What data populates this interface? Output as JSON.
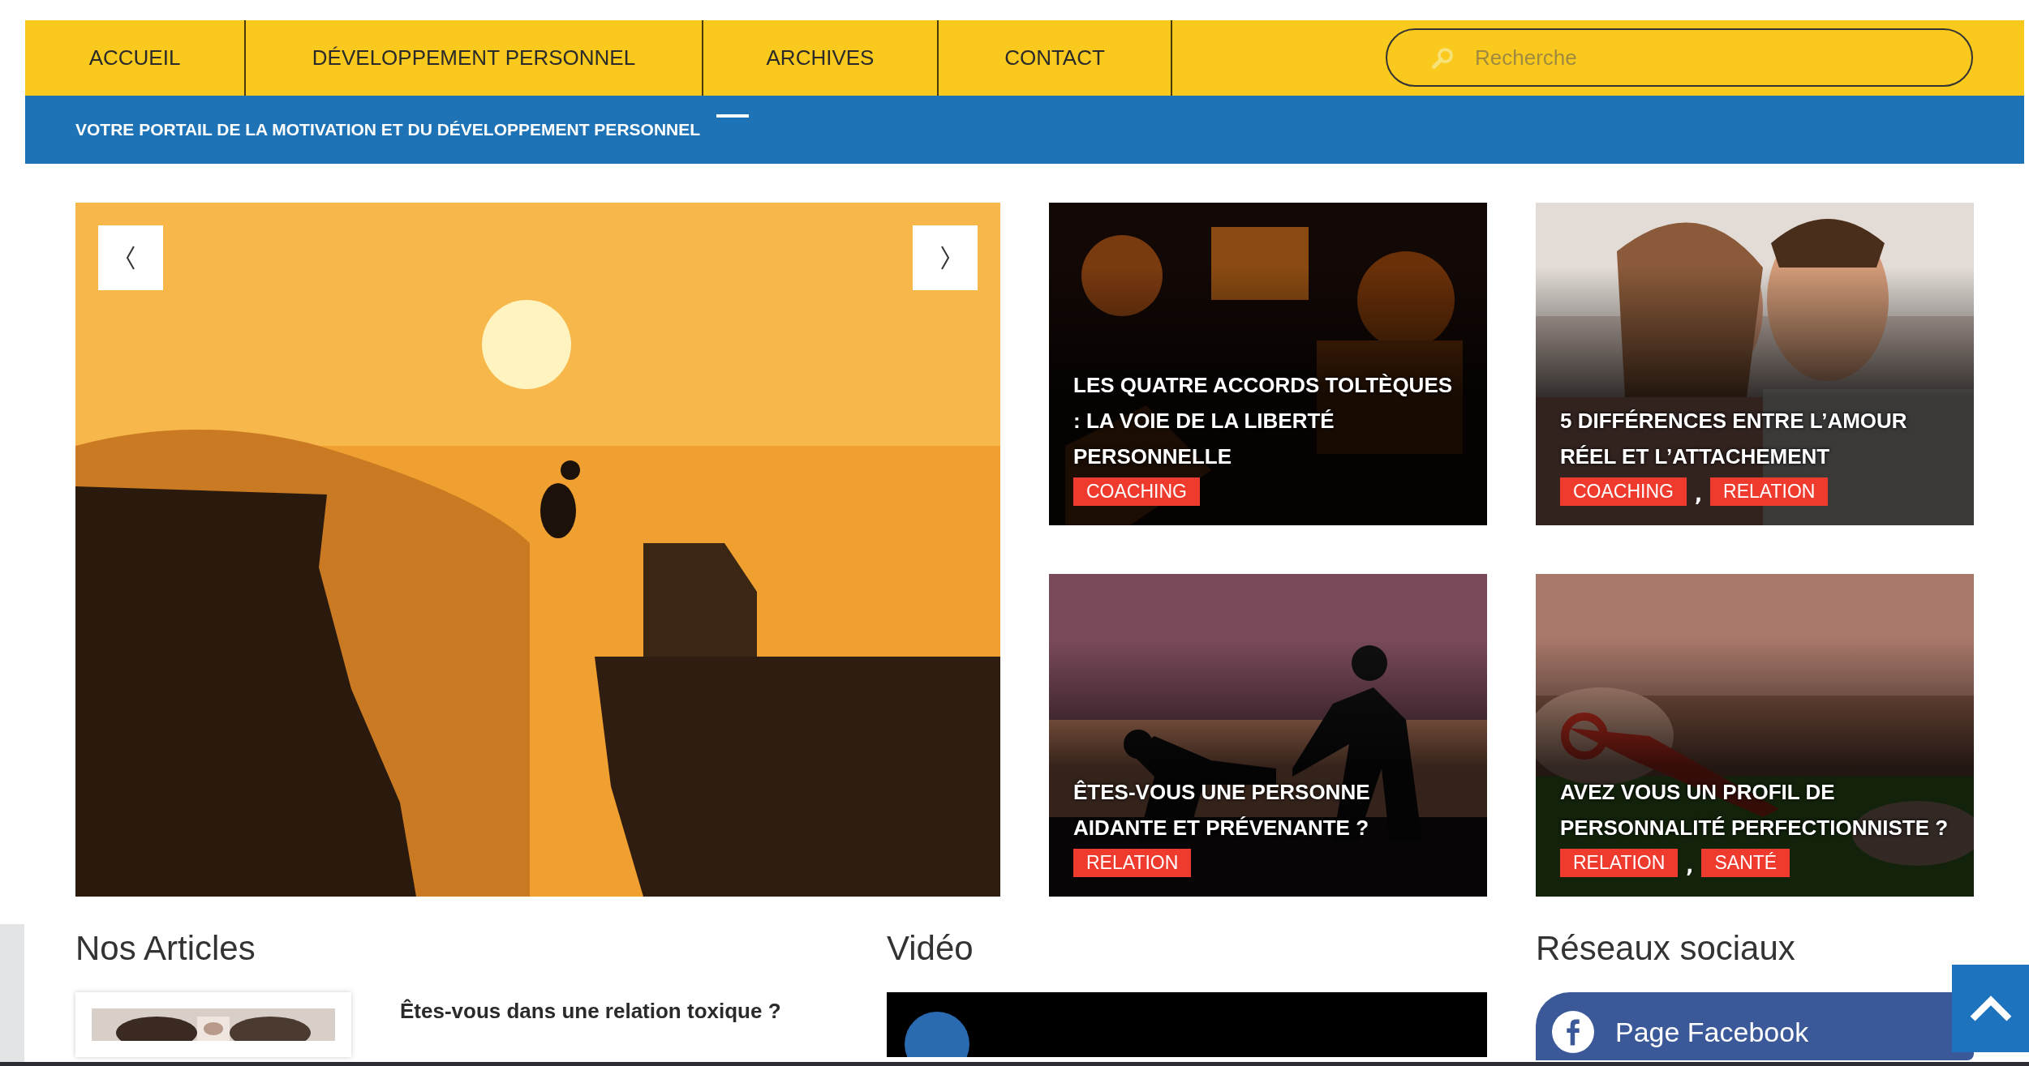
{
  "nav": {
    "items": [
      "ACCUEIL",
      "DÉVELOPPEMENT PERSONNEL",
      "ARCHIVES",
      "CONTACT"
    ]
  },
  "search": {
    "placeholder": "Recherche"
  },
  "tagline": "VOTRE PORTAIL DE LA MOTIVATION ET DU DÉVELOPPEMENT PERSONNEL",
  "tag_separator": ",",
  "featured": [
    {
      "title": "LES QUATRE ACCORDS TOLTÈQUES : LA VOIE DE LA LIBERTÉ PERSONNELLE",
      "tags": [
        "COACHING"
      ]
    },
    {
      "title": "5 DIFFÉRENCES ENTRE L’AMOUR RÉEL ET L’ATTACHEMENT",
      "tags": [
        "COACHING",
        "RELATION"
      ]
    },
    {
      "title": "ÊTES-VOUS UNE PERSONNE AIDANTE ET PRÉVENANTE ?",
      "tags": [
        "RELATION"
      ]
    },
    {
      "title": "AVEZ VOUS UN PROFIL DE PERSONNALITÉ PERFECTIONNISTE ?",
      "tags": [
        "RELATION",
        "SANTÉ"
      ]
    }
  ],
  "sections": {
    "articles": {
      "heading": "Nos Articles",
      "items": [
        {
          "title": "Êtes-vous dans une relation toxique ?"
        }
      ]
    },
    "video": {
      "heading": "Vidéo"
    },
    "social": {
      "heading": "Réseaux sociaux",
      "button": "Page Facebook"
    }
  }
}
